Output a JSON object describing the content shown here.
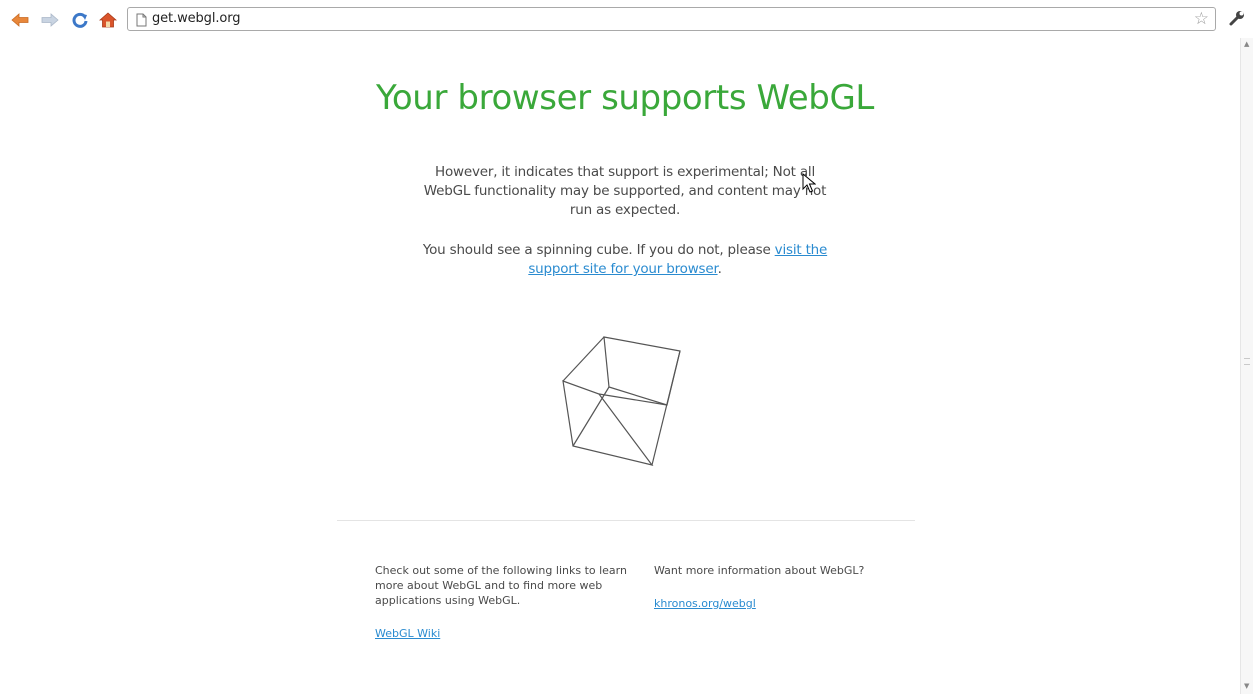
{
  "browser": {
    "url": "get.webgl.org",
    "icons": {
      "back": "back-arrow-icon",
      "forward": "forward-arrow-icon",
      "reload": "reload-icon",
      "home": "home-icon",
      "page": "page-icon",
      "bookmark": "star-icon",
      "menu": "wrench-icon"
    },
    "colors": {
      "back_arrow": "#e8873a",
      "forward_arrow": "#b7c4d6",
      "reload": "#3c78c8",
      "home": "#d9542b"
    }
  },
  "page": {
    "headline": "Your browser supports WebGL",
    "headline_color": "#3aa83a",
    "experimental_notice": "However, it indicates that support is experimental; Not all WebGL functionality may be supported, and content may not run as expected.",
    "cube_text_before": "You should see a spinning cube. If you do not, please ",
    "support_link": "visit the support site for your browser",
    "cube_text_after": ".",
    "link_color": "#2a8bd0"
  },
  "footer": {
    "left_text": "Check out some of the following links to learn more about WebGL and to find more web applications using WebGL.",
    "left_link": "WebGL Wiki",
    "right_text": "Want more information about WebGL?",
    "right_link": "khronos.org/webgl"
  }
}
